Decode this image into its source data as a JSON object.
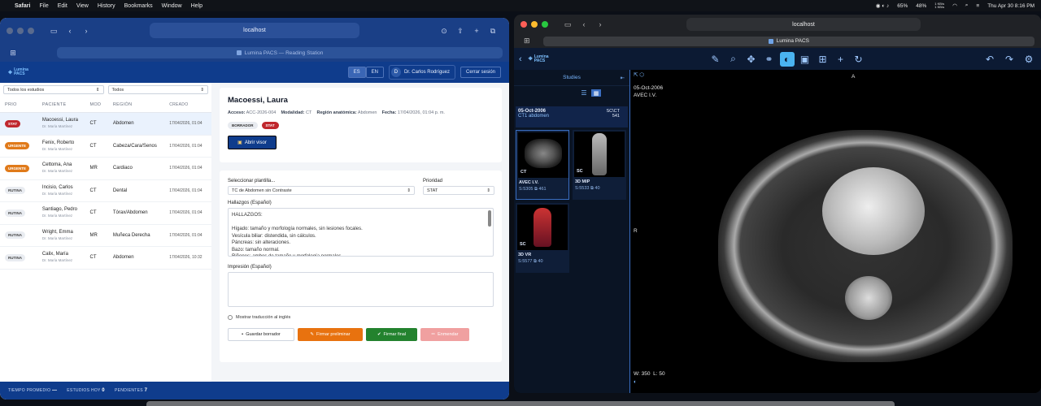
{
  "menubar": {
    "app": "Safari",
    "items": [
      "File",
      "Edit",
      "View",
      "History",
      "Bookmarks",
      "Window",
      "Help"
    ],
    "battery1": "65%",
    "battery2": "48%",
    "datetime": "Thu Apr 30  8:16 PM",
    "net1": "1 KB/s",
    "net2": "1 KB/s"
  },
  "left_window": {
    "url": "localhost",
    "tab_title": "Lumina PACS — Reading Station",
    "header": {
      "logo_line1": "Lumina",
      "logo_line2": "PACS",
      "lang_es": "ES",
      "lang_en": "EN",
      "avatar_letter": "D",
      "user": "Dr. Carlos Rodríguez",
      "logout": "Cerrar sesión"
    },
    "filters": {
      "studies": "Todos los estudios",
      "all": "Todos"
    },
    "columns": [
      "PRIO",
      "PACIENTE",
      "MOD",
      "REGIÓN",
      "CREADO"
    ],
    "rows": [
      {
        "prio": "STAT",
        "type": "stat",
        "name": "Macoessi, Laura",
        "doctor": "Dr. María Martínez",
        "mod": "CT",
        "region": "Abdomen",
        "created": "17/04/2026, 01:04"
      },
      {
        "prio": "URGENTE",
        "type": "urg",
        "name": "Fenix, Roberto",
        "doctor": "Dr. María Martínez",
        "mod": "CT",
        "region": "Cabeza/Cara/Senos",
        "created": "17/04/2026, 01:04"
      },
      {
        "prio": "URGENTE",
        "type": "urg",
        "name": "Cettoma, Ana",
        "doctor": "Dr. María Martínez",
        "mod": "MR",
        "region": "Cardiaco",
        "created": "17/04/2026, 01:04"
      },
      {
        "prio": "RUTINA",
        "type": "rut",
        "name": "Incisio, Carlos",
        "doctor": "Dr. María Martínez",
        "mod": "CT",
        "region": "Dental",
        "created": "17/04/2026, 01:04"
      },
      {
        "prio": "RUTINA",
        "type": "rut",
        "name": "Santiago, Pedro",
        "doctor": "Dr. María Martínez",
        "mod": "CT",
        "region": "Tórax/Abdomen",
        "created": "17/04/2026, 01:04"
      },
      {
        "prio": "RUTINA",
        "type": "rut",
        "name": "Wright, Emma",
        "doctor": "Dr. María Martínez",
        "mod": "MR",
        "region": "Muñeca Derecha",
        "created": "17/04/2026, 01:04"
      },
      {
        "prio": "RUTINA",
        "type": "rut",
        "name": "Calix, María",
        "doctor": "Dr. María Martínez",
        "mod": "CT",
        "region": "Abdomen",
        "created": "17/04/2026, 10:32"
      }
    ],
    "detail": {
      "title": "Macoessi, Laura",
      "acceso_lbl": "Acceso:",
      "acceso": "ACC-2026-004",
      "modalidad_lbl": "Modalidad:",
      "modalidad": "CT",
      "region_lbl": "Región anatómica:",
      "region": "Abdomen",
      "fecha_lbl": "Fecha:",
      "fecha": "17/04/2026, 01:04 p. m.",
      "tag1": "BORRADOR",
      "tag2": "STAT",
      "open": "Abrir visor"
    },
    "report": {
      "template_lbl": "Seleccionar plantilla...",
      "template_val": "TC de Abdomen sin Contraste",
      "priority_lbl": "Prioridad",
      "priority_val": "STAT",
      "findings_lbl": "Hallazgos (Español)",
      "findings": [
        "HALLAZGOS:",
        "",
        "Hígado: tamaño y morfología normales, sin lesiones focales.",
        "Vesícula biliar: distendida, sin cálculos.",
        "Páncreas: sin alteraciones.",
        "Bazo: tamaño normal.",
        "Riñones: ambos de tamaño y morfología normales."
      ],
      "impression_lbl": "Impresión (Español)",
      "show_translation": "Mostrar traducción al inglés",
      "save": "Guardar borrador",
      "prelim": "Firmar preliminar",
      "final": "Firmar final",
      "amend": "Enmendar"
    },
    "status": {
      "avg_lbl": "TIEMPO PROMEDIO",
      "avg": "—",
      "today_lbl": "ESTUDIOS HOY",
      "today": "0",
      "pending_lbl": "PENDIENTES",
      "pending": "7"
    }
  },
  "right_window": {
    "url": "localhost",
    "tab_title": "Lumina PACS",
    "logo_line1": "Lumina",
    "logo_line2": "PACS",
    "studies_lbl": "Studies",
    "study": {
      "date": "05-Oct-2006",
      "desc": "CT1 abdomen",
      "mods": "SC\\CT",
      "count": "541"
    },
    "thumbs": [
      {
        "mod": "CT",
        "name": "AVEC I.V.",
        "series": "S:5305",
        "count": "461"
      },
      {
        "mod": "SC",
        "name": "3D MIP",
        "series": "S:5533",
        "count": "40"
      },
      {
        "mod": "SC",
        "name": "3D VR",
        "series": "S:5577",
        "count": "40"
      }
    ],
    "overlay": {
      "date": "05-Oct-2006",
      "desc": "AVEC I.V.",
      "orient_top": "A",
      "orient_left": "R",
      "ww": "W: 350",
      "wl": "L: 50"
    }
  }
}
